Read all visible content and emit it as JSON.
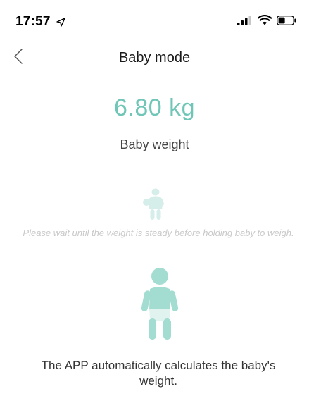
{
  "status_bar": {
    "time": "17:57"
  },
  "nav": {
    "title": "Baby mode"
  },
  "measurement": {
    "value": "6.80 kg",
    "label": "Baby weight"
  },
  "waiting": {
    "message": "Please wait until the weight is steady before holding baby to weigh."
  },
  "instruction": {
    "text": "The APP automatically calculates the baby's weight."
  },
  "colors": {
    "accent": "#6fc6b6",
    "muted": "#c9c9c9",
    "divider": "#dcdcdc"
  },
  "icons": {
    "back": "chevron-left-icon",
    "location": "location-arrow-icon",
    "signal": "cellular-signal-icon",
    "wifi": "wifi-icon",
    "battery": "battery-icon",
    "adult_holding_baby": "adult-holding-baby-icon",
    "baby": "baby-icon"
  }
}
